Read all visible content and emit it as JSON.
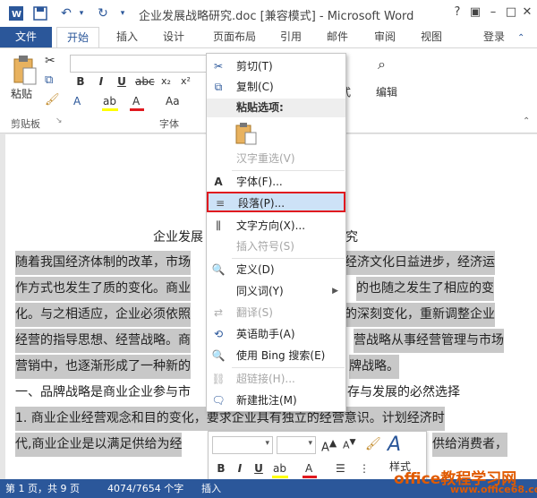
{
  "titlebar": {
    "title": "企业发展战略研究.doc [兼容模式] - Microsoft Word",
    "min_icon": "minimize-icon",
    "restore_icon": "restore-icon",
    "close_icon": "close-icon"
  },
  "qat": {
    "save_icon": "save-icon",
    "undo_icon": "undo-icon",
    "redo_icon": "redo-icon",
    "customize_icon": "chevron-down-icon"
  },
  "tabs": {
    "file": "文件",
    "items": [
      "开始",
      "插入",
      "设计",
      "页面布局",
      "引用",
      "邮件",
      "审阅",
      "视图"
    ],
    "active": "开始",
    "login": "登录"
  },
  "ribbon": {
    "paste": "粘贴",
    "clipboard_group": "剪贴板",
    "font_group": "字体",
    "bold": "B",
    "italic": "I",
    "underline": "U",
    "styles_partial": "式",
    "edit": "编辑"
  },
  "document": {
    "title_left": "企业发展",
    "title_right": "研究",
    "lines": [
      {
        "left": "随着我国经济体制的改革，市场",
        "right": "经济文化日益进步，经济运"
      },
      {
        "left": "作方式也发生了质的变化。商业",
        "right": "的也随之发生了相应的变"
      },
      {
        "left": "化。与之相适应，企业必须依照",
        "right": "的深刻变化，重新调整企业"
      },
      {
        "left": "经营的指导思想、经营战略。商",
        "right": "营战略从事经营管理与市场"
      },
      {
        "left": "营销中，也逐渐形成了一种新的",
        "right": "牌战略。"
      }
    ],
    "heading_left": "一、品牌战略是商业企业参与市",
    "heading_right": "存与发展的必然选择",
    "item1": "1. 商业企业经营观念和目的变化，要求企业具有独立的经营意识。计划经济时",
    "item2_left": "代,商业企业是以满足供给为经",
    "item2_right": "供给消费者，"
  },
  "context_menu": {
    "cut": "剪切(T)",
    "copy": "复制(C)",
    "paste_options": "粘贴选项:",
    "hanzi_reconvert": "汉字重选(V)",
    "font": "字体(F)...",
    "paragraph": "段落(P)...",
    "text_direction": "文字方向(X)...",
    "insert_symbol": "插入符号(S)",
    "define": "定义(D)",
    "synonyms": "同义词(Y)",
    "translate": "翻译(S)",
    "english_assistant": "英语助手(A)",
    "bing_search": "使用 Bing 搜索(E)",
    "hyperlink": "超链接(H)...",
    "new_comment": "新建批注(M)"
  },
  "minibar": {
    "bold": "B",
    "italic": "I",
    "underline": "U",
    "styles": "样式"
  },
  "status": {
    "page": "第 1 页，共 9 页",
    "words": "4074/7654 个字",
    "insert": "插入"
  },
  "watermark": {
    "text": "office教程学习网",
    "url": "www.office68.com"
  },
  "colors": {
    "accent": "#2b579a",
    "highlight_border": "#e0191f",
    "selection": "#c8c8c8",
    "menu_hover": "#cde2f7"
  }
}
